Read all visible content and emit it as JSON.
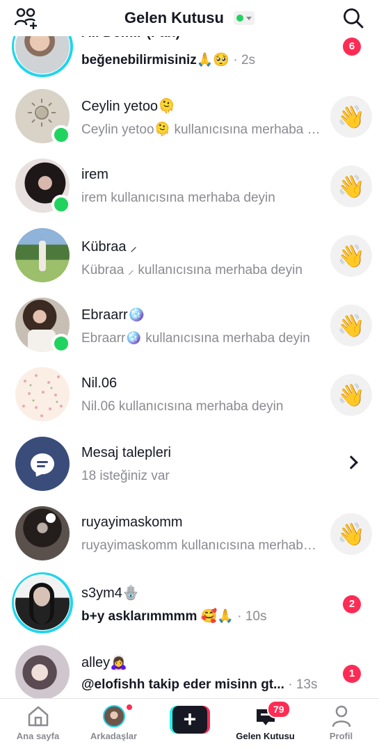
{
  "header": {
    "title": "Gelen Kutusu",
    "add_friends_icon": "add-friends-icon",
    "search_icon": "search-icon",
    "status_color": "#20d35f"
  },
  "conversations": [
    {
      "name": "Ali Demir (Fan)",
      "message": "beğenebilirmisiniz🙏🥺",
      "time": "· 2s",
      "badge": "6"
    },
    {
      "name": "Ceylin yetoo🫠",
      "message": "Ceylin yetoo🫠 kullanıcısına merhaba deyin",
      "wave": "👋"
    },
    {
      "name": "irem",
      "message": "irem kullanıcısına merhaba deyin",
      "wave": "👋"
    },
    {
      "name": "Kübraa ⸝",
      "message": "Kübraa ⸝ kullanıcısına merhaba deyin",
      "wave": "👋"
    },
    {
      "name": "Ebraarr🪩",
      "message": "Ebraarr🪩 kullanıcısına merhaba deyin",
      "wave": "👋"
    },
    {
      "name": "Nil.06",
      "message": "Nil.06 kullanıcısına merhaba deyin",
      "wave": "👋"
    },
    {
      "name": "Mesaj talepleri",
      "message": "18 isteğiniz var"
    },
    {
      "name": "ruyayimaskomm",
      "message": "ruyayimaskomm kullanıcısına merhaba deyin",
      "wave": "👋"
    },
    {
      "name": "s3ym4🪬",
      "message": "b+y asklarımmmm 🥰🙏",
      "time": "· 10s",
      "badge": "2"
    },
    {
      "name": "alley🙇‍♀️",
      "message": "@elofishh takip eder misinn gt...",
      "time": "· 13s",
      "badge": "1"
    }
  ],
  "nav": {
    "home": "Ana sayfa",
    "friends": "Arkadaşlar",
    "create": "+",
    "inbox": "Gelen Kutusu",
    "inbox_badge": "79",
    "profile": "Profil"
  },
  "colors": {
    "accent": "#fe2c55",
    "online": "#20d35f",
    "story_ring": "#20d5ec"
  }
}
